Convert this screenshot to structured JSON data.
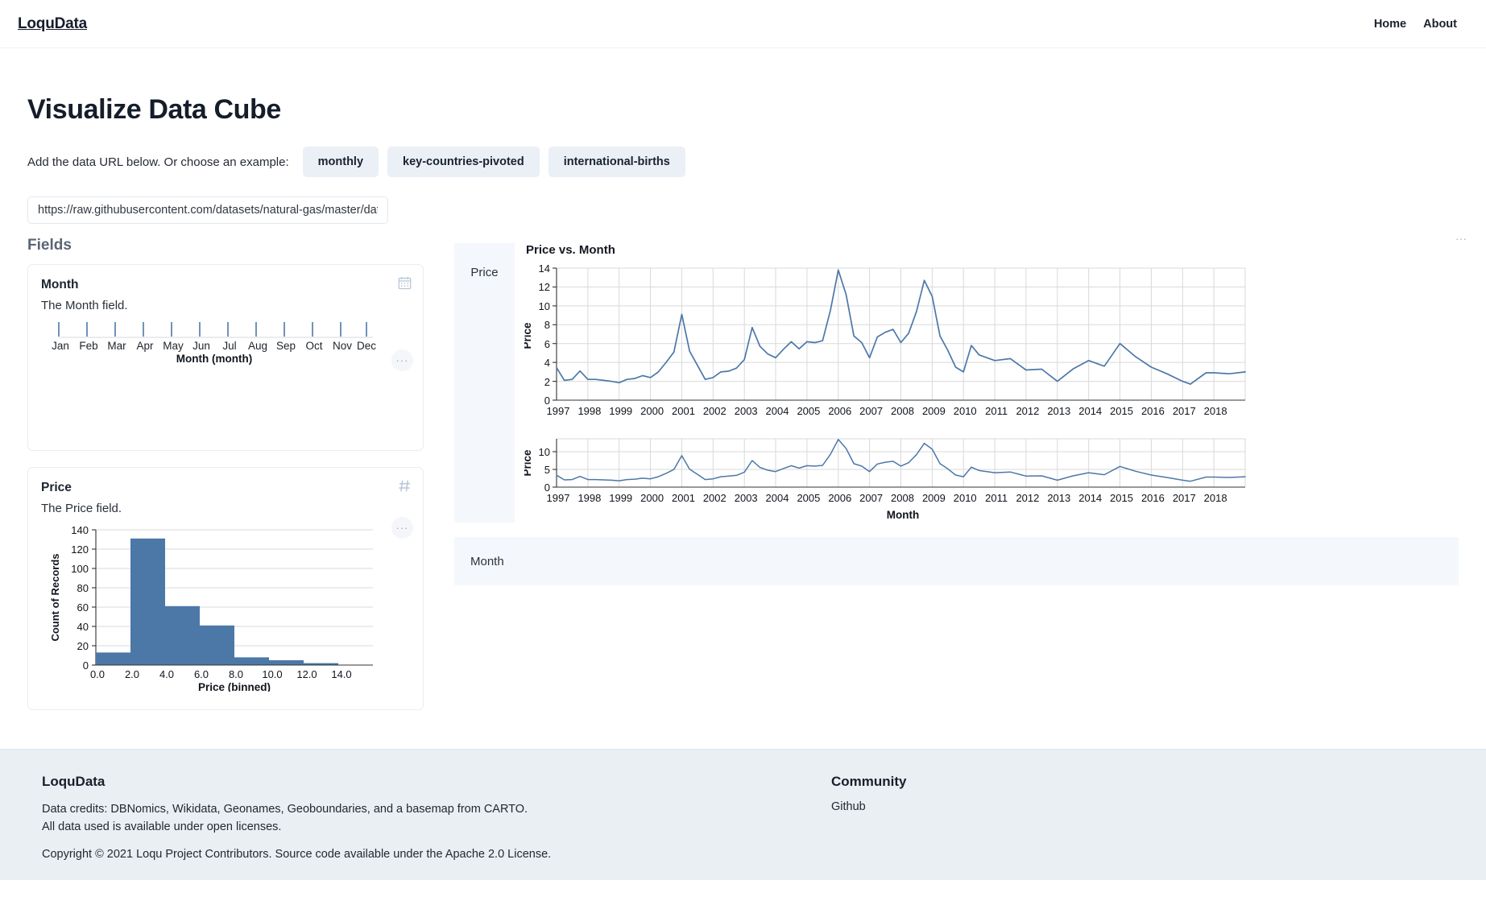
{
  "nav": {
    "brand": "LoquData",
    "links": [
      {
        "label": "Home"
      },
      {
        "label": "About"
      }
    ]
  },
  "header": {
    "title": "Visualize Data Cube",
    "example_label": "Add the data URL below. Or choose an example:",
    "examples": [
      {
        "label": "monthly"
      },
      {
        "label": "key-countries-pivoted"
      },
      {
        "label": "international-births"
      }
    ],
    "url_value": "https://raw.githubusercontent.com/datasets/natural-gas/master/data/m",
    "url_placeholder": "https://raw.githubusercontent.com/datasets/natural-gas/master/data/monthly.csv"
  },
  "fields": {
    "title": "Fields",
    "items": [
      {
        "name": "Month",
        "description": "The Month field.",
        "icon": "calendar-icon",
        "menu": "···"
      },
      {
        "name": "Price",
        "description": "The Price field.",
        "icon": "hash-icon",
        "menu": "···"
      }
    ]
  },
  "viz": {
    "title": "Price vs. Month",
    "y_shelf": "Price",
    "x_shelf": "Month",
    "menu": "···"
  },
  "footer": {
    "brand": "LoquData",
    "credits_line1": "Data credits: DBNomics, Wikidata, Geonames, Geoboundaries, and a basemap from CARTO.",
    "credits_line2": "All data used is available under open licenses.",
    "copyright": "Copyright © 2021 Loqu Project Contributors. Source code available under the Apache 2.0 License.",
    "community_title": "Community",
    "community_links": [
      {
        "label": "Github"
      }
    ]
  },
  "colors": {
    "series": "#4c78a8",
    "bar": "#4c78a8",
    "shelf_bg": "#f4f8fc",
    "chip_bg": "#eaf0f6",
    "footer_bg": "#eaeff4",
    "text": "#212529"
  },
  "chart_data": [
    {
      "id": "month-ticks",
      "type": "tick",
      "title": "",
      "xlabel": "Month (month)",
      "ylabel": "",
      "categories": [
        "Jan",
        "Feb",
        "Mar",
        "Apr",
        "May",
        "Jun",
        "Jul",
        "Aug",
        "Sep",
        "Oct",
        "Nov",
        "Dec"
      ],
      "values": [
        1,
        1,
        1,
        1,
        1,
        1,
        1,
        1,
        1,
        1,
        1,
        1
      ],
      "grid": false,
      "legend": "none"
    },
    {
      "id": "price-histogram",
      "type": "bar",
      "title": "",
      "xlabel": "Price (binned)",
      "ylabel": "Count of Records",
      "categories": [
        "0.0",
        "2.0",
        "4.0",
        "6.0",
        "8.0",
        "10.0",
        "12.0",
        "14.0"
      ],
      "bin_starts": [
        0,
        2,
        4,
        6,
        8,
        10,
        12,
        14
      ],
      "values": [
        13,
        131,
        61,
        41,
        8,
        5,
        2,
        0
      ],
      "xlim": [
        0,
        16
      ],
      "ylim": [
        0,
        140
      ],
      "yticks": [
        0,
        20,
        40,
        60,
        80,
        100,
        120,
        140
      ],
      "xticks": [
        "0.0",
        "2.0",
        "4.0",
        "6.0",
        "8.0",
        "10.0",
        "12.0",
        "14.0"
      ],
      "grid": true,
      "legend": "none"
    },
    {
      "id": "price-vs-month-main",
      "type": "line",
      "title": "Price vs. Month",
      "xlabel": "",
      "ylabel": "Price",
      "ylim": [
        0,
        14
      ],
      "yticks": [
        0,
        2,
        4,
        6,
        8,
        10,
        12,
        14
      ],
      "xticks": [
        "1997",
        "1998",
        "1999",
        "2000",
        "2001",
        "2002",
        "2003",
        "2004",
        "2005",
        "2006",
        "2007",
        "2008",
        "2009",
        "2010",
        "2011",
        "2012",
        "2013",
        "2014",
        "2015",
        "2016",
        "2017",
        "2018"
      ],
      "grid": true,
      "legend": "none",
      "series": [
        {
          "name": "Price",
          "x": [
            "1997-01",
            "1997-04",
            "1997-07",
            "1997-10",
            "1998-01",
            "1998-04",
            "1998-07",
            "1998-10",
            "1999-01",
            "1999-04",
            "1999-07",
            "1999-10",
            "2000-01",
            "2000-04",
            "2000-07",
            "2000-10",
            "2000-12",
            "2001-03",
            "2001-06",
            "2001-09",
            "2001-12",
            "2002-03",
            "2002-06",
            "2002-09",
            "2002-12",
            "2003-02",
            "2003-05",
            "2003-08",
            "2003-11",
            "2004-02",
            "2004-05",
            "2004-08",
            "2004-11",
            "2005-02",
            "2005-05",
            "2005-08",
            "2005-10",
            "2005-12",
            "2006-03",
            "2006-06",
            "2006-09",
            "2006-12",
            "2007-03",
            "2007-06",
            "2007-09",
            "2007-12",
            "2008-03",
            "2008-06",
            "2008-07",
            "2008-10",
            "2009-01",
            "2009-04",
            "2009-09",
            "2010-01",
            "2010-06",
            "2010-12",
            "2011-06",
            "2011-12",
            "2012-04",
            "2012-10",
            "2013-04",
            "2013-10",
            "2014-02",
            "2014-06",
            "2014-12",
            "2015-06",
            "2015-12",
            "2016-03",
            "2016-09",
            "2017-03",
            "2017-12",
            "2018-06",
            "2018-11"
          ],
          "values": [
            3.45,
            2.1,
            2.2,
            3.1,
            2.2,
            2.2,
            2.1,
            2.0,
            1.85,
            2.2,
            2.3,
            2.6,
            2.4,
            3.0,
            4.0,
            5.1,
            9.1,
            5.2,
            3.7,
            2.2,
            2.4,
            3.0,
            3.2,
            3.4,
            4.3,
            7.7,
            5.7,
            4.9,
            4.5,
            5.4,
            6.2,
            5.5,
            6.2,
            6.1,
            6.3,
            9.5,
            13.8,
            11.2,
            6.8,
            6.1,
            4.5,
            6.7,
            7.2,
            7.5,
            6.1,
            7.1,
            9.4,
            12.7,
            11.0,
            6.8,
            5.2,
            3.5,
            3.0,
            5.8,
            4.8,
            4.2,
            4.4,
            3.2,
            2.0,
            3.3,
            4.2,
            3.6,
            6.0,
            4.6,
            3.5,
            2.8,
            2.0,
            1.7,
            2.9,
            2.9,
            2.8,
            2.9,
            3.0
          ]
        }
      ]
    },
    {
      "id": "price-vs-month-mini",
      "type": "line",
      "title": "",
      "xlabel": "Month",
      "ylabel": "Price",
      "ylim": [
        0,
        14
      ],
      "yticks": [
        0,
        5,
        10
      ],
      "xticks": [
        "1997",
        "1998",
        "1999",
        "2000",
        "2001",
        "2002",
        "2003",
        "2004",
        "2005",
        "2006",
        "2007",
        "2008",
        "2009",
        "2010",
        "2011",
        "2012",
        "2013",
        "2014",
        "2015",
        "2016",
        "2017",
        "2018"
      ],
      "grid": true,
      "legend": "none",
      "series": [
        {
          "name": "Price",
          "x": [
            "1997-01",
            "1997-04",
            "1997-07",
            "1997-10",
            "1998-01",
            "1998-04",
            "1998-07",
            "1998-10",
            "1999-01",
            "1999-04",
            "1999-07",
            "1999-10",
            "2000-01",
            "2000-04",
            "2000-07",
            "2000-10",
            "2000-12",
            "2001-03",
            "2001-06",
            "2001-09",
            "2001-12",
            "2002-03",
            "2002-06",
            "2002-09",
            "2002-12",
            "2003-02",
            "2003-05",
            "2003-08",
            "2003-11",
            "2004-02",
            "2004-05",
            "2004-08",
            "2004-11",
            "2005-02",
            "2005-05",
            "2005-08",
            "2005-10",
            "2005-12",
            "2006-03",
            "2006-06",
            "2006-09",
            "2006-12",
            "2007-03",
            "2007-06",
            "2007-09",
            "2007-12",
            "2008-03",
            "2008-06",
            "2008-07",
            "2008-10",
            "2009-01",
            "2009-04",
            "2009-09",
            "2010-01",
            "2010-06",
            "2010-12",
            "2011-06",
            "2011-12",
            "2012-04",
            "2012-10",
            "2013-04",
            "2013-10",
            "2014-02",
            "2014-06",
            "2014-12",
            "2015-06",
            "2015-12",
            "2016-03",
            "2016-09",
            "2017-03",
            "2017-12",
            "2018-06",
            "2018-11"
          ],
          "values": [
            3.45,
            2.1,
            2.2,
            3.1,
            2.2,
            2.2,
            2.1,
            2.0,
            1.85,
            2.2,
            2.3,
            2.6,
            2.4,
            3.0,
            4.0,
            5.1,
            9.1,
            5.2,
            3.7,
            2.2,
            2.4,
            3.0,
            3.2,
            3.4,
            4.3,
            7.7,
            5.7,
            4.9,
            4.5,
            5.4,
            6.2,
            5.5,
            6.2,
            6.1,
            6.3,
            9.5,
            13.8,
            11.2,
            6.8,
            6.1,
            4.5,
            6.7,
            7.2,
            7.5,
            6.1,
            7.1,
            9.4,
            12.7,
            11.0,
            6.8,
            5.2,
            3.5,
            3.0,
            5.8,
            4.8,
            4.2,
            4.4,
            3.2,
            2.0,
            3.3,
            4.2,
            3.6,
            6.0,
            4.6,
            3.5,
            2.8,
            2.0,
            1.7,
            2.9,
            2.9,
            2.8,
            2.9,
            3.0
          ]
        }
      ]
    }
  ]
}
